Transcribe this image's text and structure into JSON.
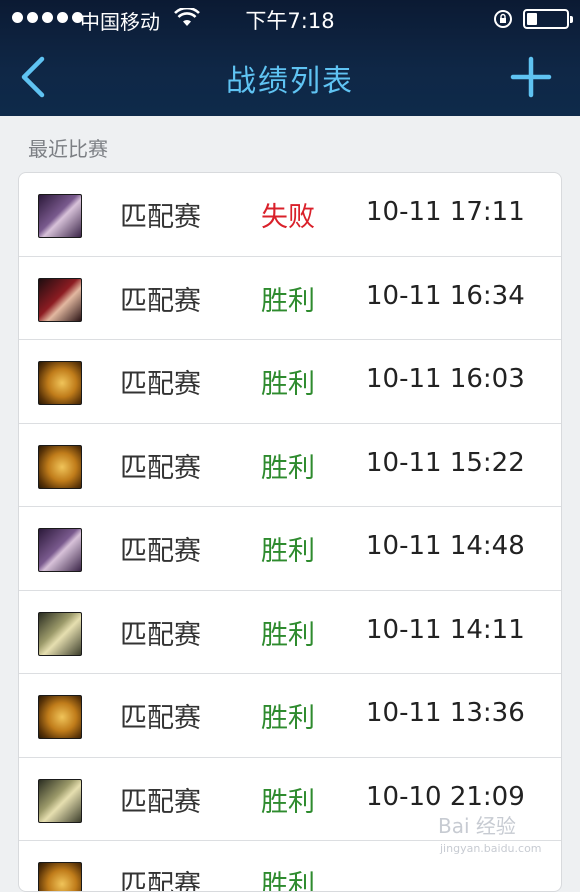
{
  "status_bar": {
    "carrier": "中国移动",
    "time": "下午7:18"
  },
  "nav": {
    "title": "战绩列表",
    "back_icon": "chevron-left-icon",
    "add_icon": "plus-icon"
  },
  "section": {
    "label": "最近比赛"
  },
  "matches": [
    {
      "mode": "匹配赛",
      "result": "失败",
      "outcome": "loss",
      "time": "10-11 17:11",
      "champion_icon": "lady"
    },
    {
      "mode": "匹配赛",
      "result": "胜利",
      "outcome": "win",
      "time": "10-11 16:34",
      "champion_icon": "red"
    },
    {
      "mode": "匹配赛",
      "result": "胜利",
      "outcome": "win",
      "time": "10-11 16:03",
      "champion_icon": "gold"
    },
    {
      "mode": "匹配赛",
      "result": "胜利",
      "outcome": "win",
      "time": "10-11 15:22",
      "champion_icon": "gold"
    },
    {
      "mode": "匹配赛",
      "result": "胜利",
      "outcome": "win",
      "time": "10-11 14:48",
      "champion_icon": "lady"
    },
    {
      "mode": "匹配赛",
      "result": "胜利",
      "outcome": "win",
      "time": "10-11 14:11",
      "champion_icon": "armor"
    },
    {
      "mode": "匹配赛",
      "result": "胜利",
      "outcome": "win",
      "time": "10-11 13:36",
      "champion_icon": "gold"
    },
    {
      "mode": "匹配赛",
      "result": "胜利",
      "outcome": "win",
      "time": "10-10 21:09",
      "champion_icon": "armor"
    },
    {
      "mode": "匹配赛",
      "result": "胜利",
      "outcome": "win",
      "time": "",
      "champion_icon": "gold"
    }
  ],
  "colors": {
    "nav_title": "#5fc3f2",
    "win": "#2e8b2e",
    "loss": "#d9202a",
    "header_bg": "#0f2746"
  },
  "watermark": {
    "brand": "Bai 经验",
    "url": "jingyan.baidu.com"
  }
}
